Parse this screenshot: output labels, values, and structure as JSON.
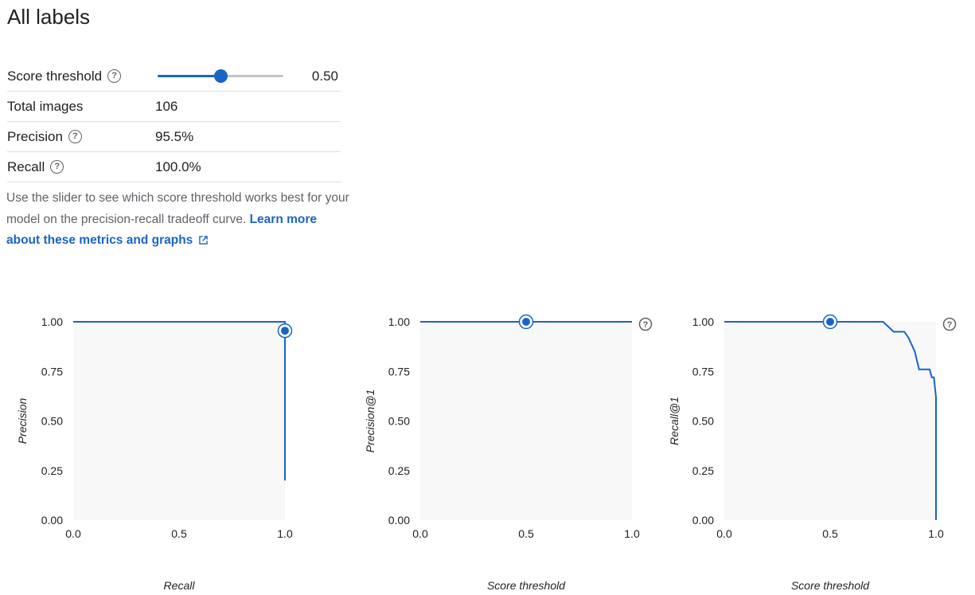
{
  "header": {
    "title": "All labels"
  },
  "metrics": {
    "score_threshold_label": "Score threshold",
    "score_threshold_value": "0.50",
    "score_threshold_fraction": 0.5,
    "total_images_label": "Total images",
    "total_images_value": "106",
    "precision_label": "Precision",
    "precision_value": "95.5%",
    "recall_label": "Recall",
    "recall_value": "100.0%"
  },
  "description": {
    "text": "Use the slider to see which score threshold works best for your model on the precision-recall tradeoff curve.",
    "link_text": "Learn more about these metrics and graphs"
  },
  "icons": {
    "help": "help-circle-icon",
    "external_link": "open-in-new-icon"
  },
  "colors": {
    "accent": "#1a64c8",
    "plot_bg": "#f8f8f8"
  },
  "chart_data": [
    {
      "type": "line",
      "xlabel": "Recall",
      "ylabel": "Precision",
      "xlim": [
        0,
        1
      ],
      "ylim": [
        0,
        1
      ],
      "x_ticks": [
        "0.0",
        "0.5",
        "1.0"
      ],
      "y_ticks": [
        "0.00",
        "0.25",
        "0.50",
        "0.75",
        "1.00"
      ],
      "series": [
        {
          "x": [
            0.0,
            1.0,
            1.0,
            1.0
          ],
          "y": [
            1.0,
            1.0,
            0.955,
            0.2
          ]
        }
      ],
      "marker": {
        "x": 1.0,
        "y": 0.955
      },
      "help_icon": false
    },
    {
      "type": "line",
      "xlabel": "Score threshold",
      "ylabel": "Precision@1",
      "xlim": [
        0,
        1
      ],
      "ylim": [
        0,
        1
      ],
      "x_ticks": [
        "0.0",
        "0.5",
        "1.0"
      ],
      "y_ticks": [
        "0.00",
        "0.25",
        "0.50",
        "0.75",
        "1.00"
      ],
      "series": [
        {
          "x": [
            0.0,
            1.0
          ],
          "y": [
            1.0,
            1.0
          ]
        }
      ],
      "marker": {
        "x": 0.5,
        "y": 1.0
      },
      "help_icon": true
    },
    {
      "type": "line",
      "xlabel": "Score threshold",
      "ylabel": "Recall@1",
      "xlim": [
        0,
        1
      ],
      "ylim": [
        0,
        1
      ],
      "x_ticks": [
        "0.0",
        "0.5",
        "1.0"
      ],
      "y_ticks": [
        "0.00",
        "0.25",
        "0.50",
        "0.75",
        "1.00"
      ],
      "series": [
        {
          "x": [
            0.0,
            0.75,
            0.8,
            0.85,
            0.87,
            0.9,
            0.92,
            0.95,
            0.97,
            0.98,
            0.99,
            1.0,
            1.0
          ],
          "y": [
            1.0,
            1.0,
            0.95,
            0.95,
            0.92,
            0.85,
            0.76,
            0.76,
            0.76,
            0.72,
            0.72,
            0.62,
            0.0
          ]
        }
      ],
      "marker": {
        "x": 0.5,
        "y": 1.0
      },
      "help_icon": true
    }
  ]
}
